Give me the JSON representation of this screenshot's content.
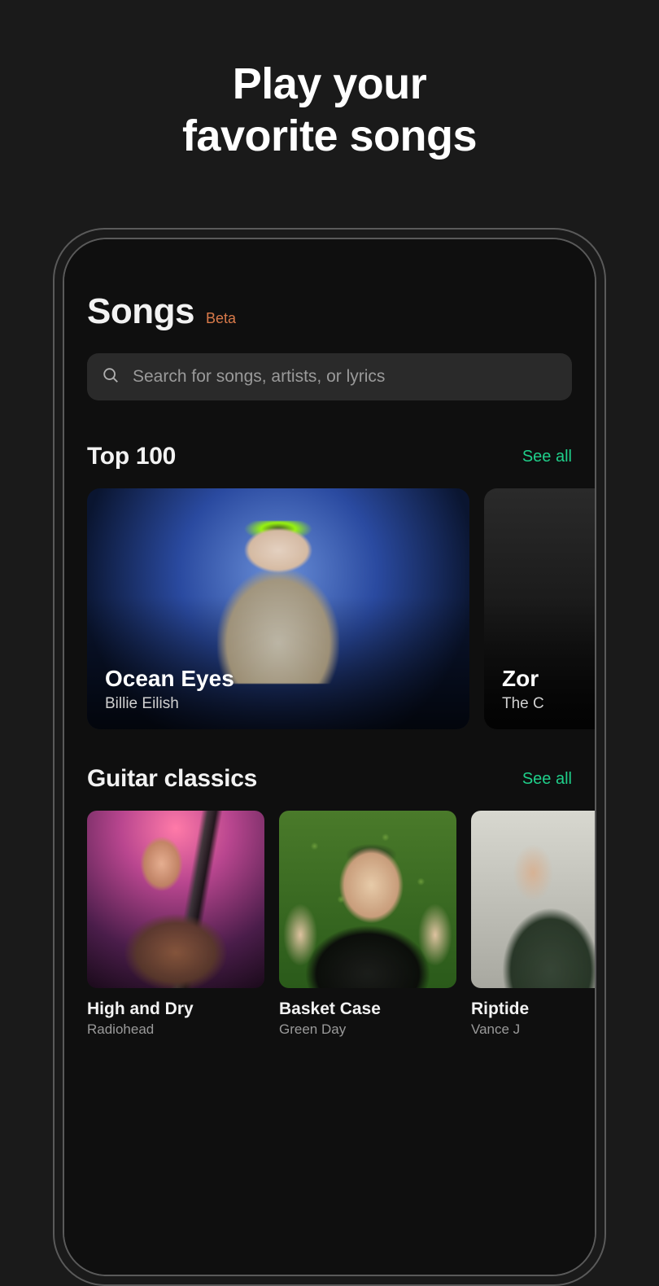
{
  "hero": {
    "line1": "Play your",
    "line2": "favorite songs"
  },
  "page": {
    "title": "Songs",
    "badge": "Beta"
  },
  "search": {
    "placeholder": "Search for songs, artists, or lyrics"
  },
  "sections": [
    {
      "title": "Top 100",
      "see_all": "See all",
      "cards": [
        {
          "title": "Ocean Eyes",
          "artist": "Billie Eilish"
        },
        {
          "title": "Zor",
          "artist": "The C"
        }
      ]
    },
    {
      "title": "Guitar classics",
      "see_all": "See all",
      "cards": [
        {
          "title": "High and Dry",
          "artist": "Radiohead"
        },
        {
          "title": "Basket Case",
          "artist": "Green Day"
        },
        {
          "title": "Riptide",
          "artist": "Vance J"
        }
      ]
    }
  ]
}
